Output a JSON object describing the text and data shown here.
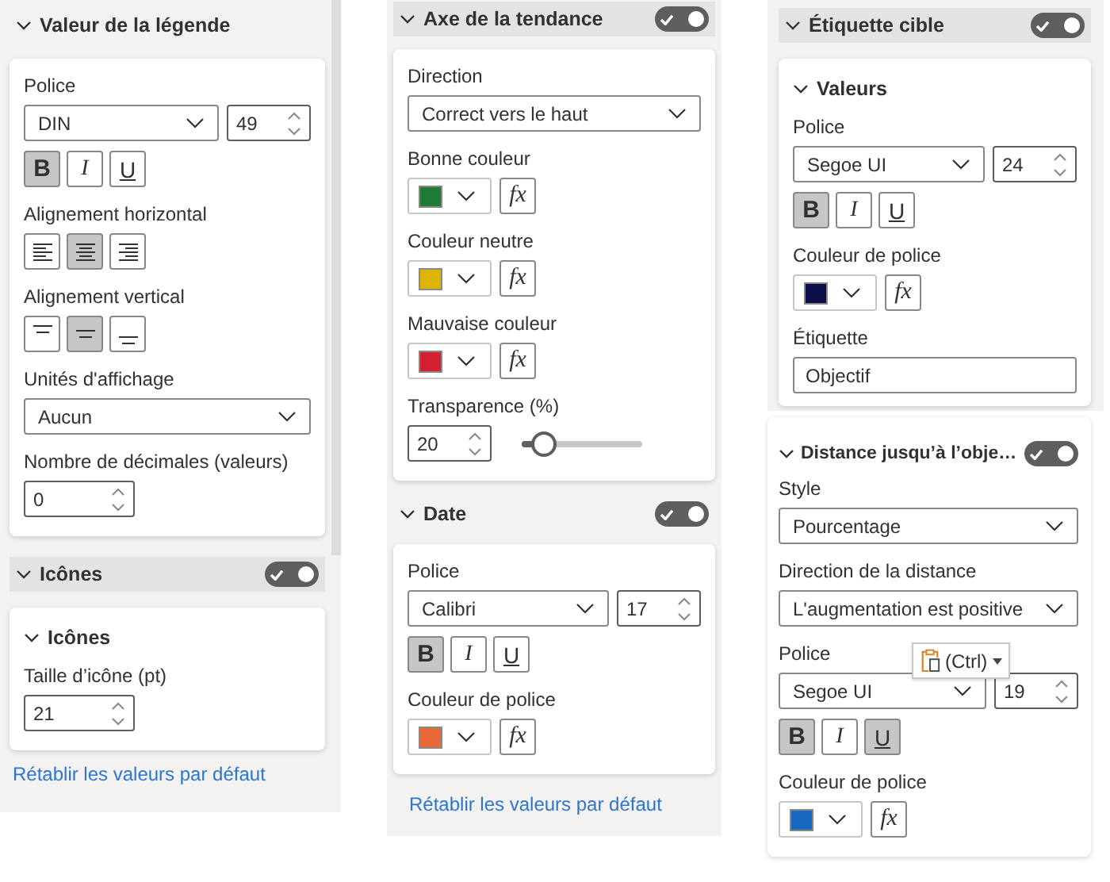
{
  "panels": [
    {
      "sections": [
        {
          "kind": "section",
          "title": "Valeur de la légende",
          "expanded": true,
          "highlighted": false,
          "items": [
            {
              "kind": "font",
              "label": "Police",
              "font": "DIN",
              "size": "49"
            },
            {
              "kind": "format",
              "buttons": [
                {
                  "label": "B",
                  "selected": true
                },
                {
                  "label": "I",
                  "selected": false
                },
                {
                  "label": "U",
                  "selected": false
                }
              ]
            },
            {
              "kind": "halign",
              "label": "Alignement horizontal",
              "options": [
                {
                  "selected": false
                },
                {
                  "selected": true
                },
                {
                  "selected": false
                }
              ]
            },
            {
              "kind": "valign",
              "label": "Alignement vertical",
              "options": [
                {
                  "selected": false
                },
                {
                  "selected": true
                },
                {
                  "selected": false
                }
              ]
            },
            {
              "kind": "dropdown",
              "label": "Unités d'affichage",
              "value": "Aucun"
            },
            {
              "kind": "spin",
              "label": "Nombre de décimales (valeurs)",
              "value": "0"
            }
          ]
        },
        {
          "kind": "section",
          "title": "Icônes",
          "expanded": true,
          "highlighted": true,
          "toggle": {
            "on": true
          },
          "items": [
            {
              "kind": "subheader",
              "label": "Icônes",
              "expanded": true
            },
            {
              "kind": "spin",
              "label": "Taille d’icône (pt)",
              "value": "21"
            }
          ]
        }
      ],
      "reset_link": "Rétablir les valeurs par défaut"
    },
    {
      "sections": [
        {
          "kind": "section",
          "title": "Axe de la tendance",
          "expanded": true,
          "highlighted": true,
          "toggle": {
            "on": true
          },
          "items": [
            {
              "kind": "dropdown",
              "label": "Direction",
              "value": "Correct vers le haut"
            },
            {
              "kind": "color",
              "label": "Bonne couleur",
              "color": "#1e7b34",
              "fx": "fx"
            },
            {
              "kind": "color",
              "label": "Couleur neutre",
              "color": "#ddb400",
              "fx": "fx"
            },
            {
              "kind": "color",
              "label": "Mauvaise couleur",
              "color": "#d22030",
              "fx": "fx"
            },
            {
              "kind": "spin_slider",
              "label": "Transparence (%)",
              "value": "20",
              "level": 0.2
            }
          ]
        },
        {
          "kind": "section",
          "title": "Date",
          "expanded": true,
          "highlighted": false,
          "toggle": {
            "on": true
          },
          "items": [
            {
              "kind": "font",
              "label": "Police",
              "font": "Calibri",
              "size": "17"
            },
            {
              "kind": "format",
              "buttons": [
                {
                  "label": "B",
                  "selected": true
                },
                {
                  "label": "I",
                  "selected": false
                },
                {
                  "label": "U",
                  "selected": false
                }
              ]
            },
            {
              "kind": "color",
              "label": "Couleur de police",
              "color": "#e8683a",
              "fx": "fx"
            }
          ]
        }
      ],
      "reset_link": "Rétablir les valeurs par défaut"
    },
    {
      "sections": [
        {
          "kind": "section",
          "title": "Étiquette cible",
          "expanded": true,
          "highlighted": true,
          "toggle": {
            "on": true
          },
          "items": [
            {
              "kind": "subheader",
              "label": "Valeurs",
              "expanded": true
            },
            {
              "kind": "font",
              "label": "Police",
              "font": "Segoe UI",
              "size": "24"
            },
            {
              "kind": "format",
              "buttons": [
                {
                  "label": "B",
                  "selected": true
                },
                {
                  "label": "I",
                  "selected": false
                },
                {
                  "label": "U",
                  "selected": false
                }
              ]
            },
            {
              "kind": "color",
              "label": "Couleur de police",
              "color": "#0b0e48",
              "fx": "fx"
            },
            {
              "kind": "text",
              "label": "Étiquette",
              "value": "Objectif"
            }
          ]
        },
        {
          "kind": "card_section",
          "title": "Distance jusqu’à l’obje…",
          "expanded": true,
          "highlighted": false,
          "toggle": {
            "on": true
          },
          "items": [
            {
              "kind": "dropdown",
              "label": "Style",
              "value": "Pourcentage"
            },
            {
              "kind": "dropdown",
              "label": "Direction de la distance",
              "value": "L'augmentation est positive"
            },
            {
              "kind": "font",
              "label": "Police",
              "font": "Segoe UI",
              "size": "19",
              "paste_popup": "(Ctrl)"
            },
            {
              "kind": "format",
              "buttons": [
                {
                  "label": "B",
                  "selected": true
                },
                {
                  "label": "I",
                  "selected": false
                },
                {
                  "label": "U",
                  "selected": true
                }
              ]
            },
            {
              "kind": "color",
              "label": "Couleur de police",
              "color": "#1769c0",
              "fx": "fx"
            }
          ]
        }
      ]
    }
  ]
}
